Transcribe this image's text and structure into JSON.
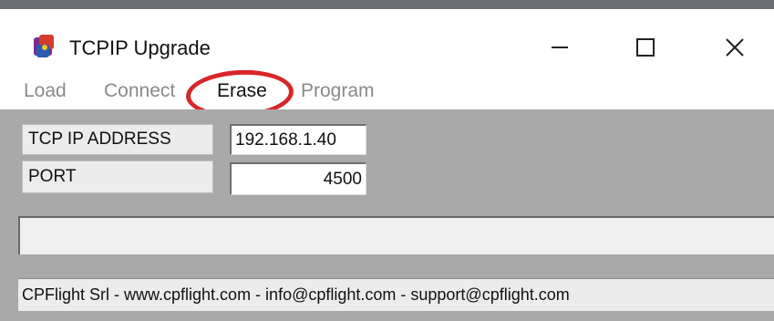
{
  "window": {
    "title": "TCPIP Upgrade",
    "controls": {
      "minimize": "—",
      "maximize": "☐",
      "close": "✕"
    }
  },
  "menu": {
    "items": [
      {
        "label": "Load"
      },
      {
        "label": "Connect"
      },
      {
        "label": "Erase"
      },
      {
        "label": "Program"
      }
    ],
    "highlighted_item": "Erase",
    "highlight_color": "#d8262b"
  },
  "form": {
    "ip_label": "TCP IP ADDRESS",
    "ip_value": "192.168.1.40",
    "port_label": "PORT",
    "port_value": "4500"
  },
  "status": {
    "text": "CPFlight Srl - www.cpflight.com - info@cpflight.com - support@cpflight.com"
  },
  "colors": {
    "panel_bg": "#a9a9a9",
    "label_bg": "#ececec"
  }
}
